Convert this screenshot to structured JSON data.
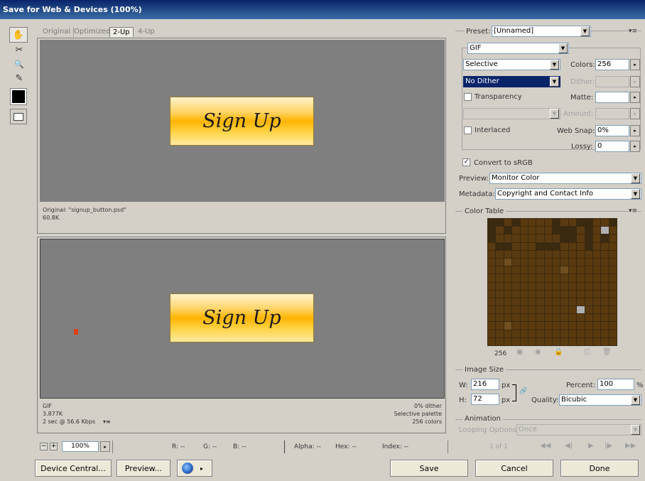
{
  "window": {
    "title": "Save for Web & Devices (100%)"
  },
  "tools": [
    {
      "name": "hand-icon",
      "glyph": "✋"
    },
    {
      "name": "slice-select-icon",
      "glyph": "✂"
    },
    {
      "name": "zoom-icon",
      "glyph": "🔍"
    },
    {
      "name": "eyedropper-icon",
      "glyph": "✎"
    }
  ],
  "tabs": [
    "Original",
    "Optimized",
    "2-Up",
    "4-Up"
  ],
  "active_tab": "2-Up",
  "top_pane": {
    "button_text": "Sign Up",
    "info_line1": "Original: \"signup_button.psd\"",
    "info_line2": "60.8K"
  },
  "bottom_pane": {
    "button_text": "Sign Up",
    "info_left1": "GIF",
    "info_left2": "3.877K",
    "info_left3": "2 sec @ 56.6 Kbps",
    "info_left3_icon": "▾≡",
    "info_right1": "0% dither",
    "info_right2": "Selective palette",
    "info_right3": "256 colors"
  },
  "statusbar": {
    "zoom": "100%",
    "r": "R: --",
    "g": "G: --",
    "b": "B: --",
    "alpha": "Alpha: --",
    "hex": "Hex: --",
    "index": "Index: --"
  },
  "settings": {
    "preset_label": "Preset:",
    "preset_value": "[Unnamed]",
    "format": "GIF",
    "reduction": "Selective",
    "colors_label": "Colors:",
    "colors_value": "256",
    "dither_algo": "No Dither",
    "dither_label": "Dither:",
    "transparency_label": "Transparency",
    "matte_label": "Matte:",
    "amount_label": "Amount:",
    "interlaced_label": "Interlaced",
    "websnap_label": "Web Snap:",
    "websnap_value": "0%",
    "lossy_label": "Lossy:",
    "lossy_value": "0",
    "convert_srgb_label": "Convert to sRGB",
    "preview_label": "Preview:",
    "preview_value": "Monitor Color",
    "metadata_label": "Metadata:",
    "metadata_value": "Copyright and Contact Info"
  },
  "color_table": {
    "label": "Color Table",
    "count": "256"
  },
  "image_size": {
    "label": "Image Size",
    "w_label": "W:",
    "w_value": "216",
    "h_label": "H:",
    "h_value": "72",
    "unit": "px",
    "percent_label": "Percent:",
    "percent_value": "100",
    "percent_unit": "%",
    "quality_label": "Quality:",
    "quality_value": "Bicubic"
  },
  "animation": {
    "label": "Animation",
    "looping_label": "Looping Options:",
    "looping_value": "Once",
    "frame_counter": "1 of 1"
  },
  "buttons": {
    "device_central": "Device Central...",
    "preview": "Preview...",
    "save": "Save",
    "cancel": "Cancel",
    "done": "Done"
  },
  "colors": {
    "title_bar": "#0a246a",
    "canvas_bg": "#7f7f7f",
    "button_orange": "#ffb400"
  }
}
